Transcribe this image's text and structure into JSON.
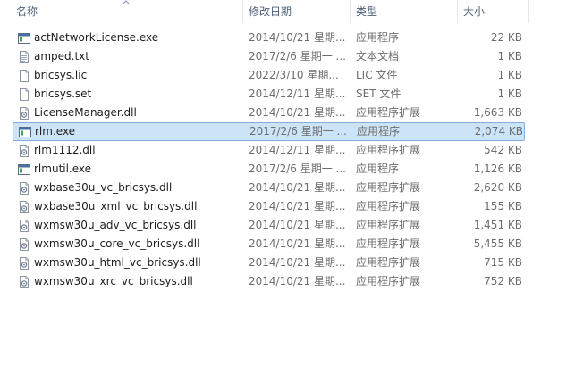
{
  "columns": {
    "name": "名称",
    "date": "修改日期",
    "type": "类型",
    "size": "大小"
  },
  "files": [
    {
      "name": "actNetworkLicense.exe",
      "date": "2014/10/21 星期...",
      "type": "应用程序",
      "size": "22 KB",
      "icon": "exe-icon"
    },
    {
      "name": "amped.txt",
      "date": "2017/2/6 星期一 ...",
      "type": "文本文档",
      "size": "1 KB",
      "icon": "txt-icon"
    },
    {
      "name": "bricsys.lic",
      "date": "2022/3/10 星期...",
      "type": "LIC 文件",
      "size": "1 KB",
      "icon": "file-icon"
    },
    {
      "name": "bricsys.set",
      "date": "2014/12/11 星期...",
      "type": "SET 文件",
      "size": "1 KB",
      "icon": "file-icon"
    },
    {
      "name": "LicenseManager.dll",
      "date": "2014/10/21 星期...",
      "type": "应用程序扩展",
      "size": "1,663 KB",
      "icon": "dll-icon"
    },
    {
      "name": "rlm.exe",
      "date": "2017/2/6 星期一 ...",
      "type": "应用程序",
      "size": "2,074 KB",
      "icon": "exe-icon"
    },
    {
      "name": "rlm1112.dll",
      "date": "2014/12/11 星期...",
      "type": "应用程序扩展",
      "size": "542 KB",
      "icon": "dll-icon"
    },
    {
      "name": "rlmutil.exe",
      "date": "2017/2/6 星期一 ...",
      "type": "应用程序",
      "size": "1,126 KB",
      "icon": "exe-icon"
    },
    {
      "name": "wxbase30u_vc_bricsys.dll",
      "date": "2014/10/21 星期...",
      "type": "应用程序扩展",
      "size": "2,620 KB",
      "icon": "dll-icon"
    },
    {
      "name": "wxbase30u_xml_vc_bricsys.dll",
      "date": "2014/10/21 星期...",
      "type": "应用程序扩展",
      "size": "155 KB",
      "icon": "dll-icon"
    },
    {
      "name": "wxmsw30u_adv_vc_bricsys.dll",
      "date": "2014/10/21 星期...",
      "type": "应用程序扩展",
      "size": "1,451 KB",
      "icon": "dll-icon"
    },
    {
      "name": "wxmsw30u_core_vc_bricsys.dll",
      "date": "2014/10/21 星期...",
      "type": "应用程序扩展",
      "size": "5,455 KB",
      "icon": "dll-icon"
    },
    {
      "name": "wxmsw30u_html_vc_bricsys.dll",
      "date": "2014/10/21 星期...",
      "type": "应用程序扩展",
      "size": "715 KB",
      "icon": "dll-icon"
    },
    {
      "name": "wxmsw30u_xrc_vc_bricsys.dll",
      "date": "2014/10/21 星期...",
      "type": "应用程序扩展",
      "size": "752 KB",
      "icon": "dll-icon"
    }
  ],
  "selected_file": "rlm.exe",
  "colors": {
    "header_text": "#4c607a",
    "selection_fill": "#cce4f7",
    "selection_border": "#84acdd"
  }
}
